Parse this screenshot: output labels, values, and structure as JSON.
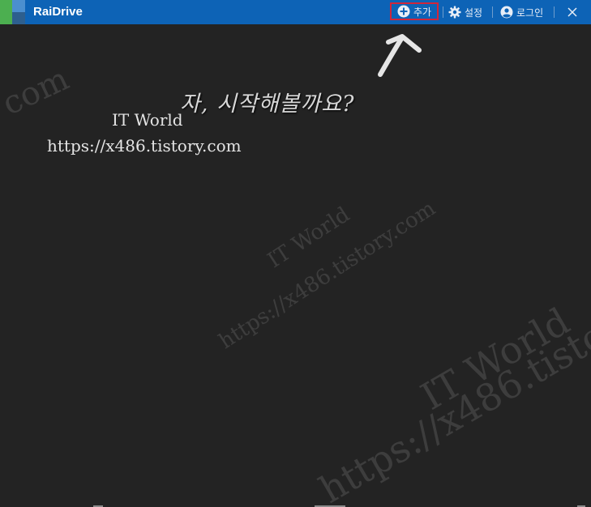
{
  "app": {
    "title": "RaiDrive"
  },
  "toolbar": {
    "add_label": "추가",
    "settings_label": "설정",
    "login_label": "로그인"
  },
  "overlay": {
    "caption": "자, 시작해볼까요?",
    "watermark_name": "IT World",
    "watermark_url": "https://x486.tistory.com",
    "watermark_fragment": "com"
  },
  "colors": {
    "titlebar": "#0d63b6",
    "background": "#232323",
    "highlight": "#d0263a"
  },
  "icons": [
    "plus-circle-icon",
    "gear-icon",
    "user-circle-icon",
    "close-icon"
  ]
}
